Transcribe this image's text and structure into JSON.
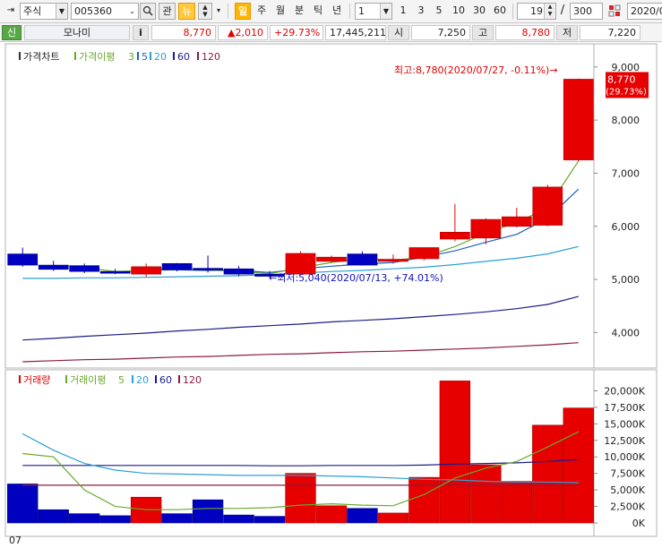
{
  "toolbar": {
    "market": "주식",
    "code": "005360",
    "btn_watch": "관",
    "btn_news": "뉴",
    "periods": [
      "일",
      "주",
      "월",
      "분",
      "틱",
      "년"
    ],
    "interval": "1",
    "quick": [
      "1",
      "3",
      "5",
      "10",
      "30",
      "60"
    ],
    "count": "19",
    "slash": "/",
    "total": "300",
    "date": "2020/0"
  },
  "quote": {
    "tag": "신",
    "name": "모나미",
    "info": "i",
    "price": "8,770",
    "change": "▲2,010",
    "rate": "+29.73%",
    "volume": "17,445,211",
    "open_label": "시",
    "open": "7,250",
    "high_label": "고",
    "high": "8,780",
    "low_label": "저",
    "low": "7,220"
  },
  "colors": {
    "up": "#e60000",
    "down": "#0000c0",
    "ma3": "#6aa82c",
    "ma5": "#1a5fc0",
    "ma20": "#2a9fd6",
    "ma60": "#1b1b8c",
    "ma120": "#8c1b3c",
    "vma5": "#6aa82c",
    "vma20": "#2a9fd6",
    "vma60": "#1b1b8c",
    "vma120": "#8c1b3c"
  },
  "chart_data": [
    {
      "type": "candlestick",
      "legend": {
        "title": "가격차트",
        "ma_label": "가격이평",
        "periods": [
          "3",
          "5",
          "20",
          "60",
          "120"
        ]
      },
      "ylim": [
        3400,
        9300
      ],
      "yticks": [
        "9,000",
        "8,000",
        "7,000",
        "6,000",
        "5,000",
        "4,000"
      ],
      "ytick_values": [
        9000,
        8000,
        7000,
        6000,
        5000,
        4000
      ],
      "current_label": "8,770",
      "current_rate_label": "(29.73%)",
      "current_value": 8770,
      "high_annotation": "최고:8,780(2020/07/27, -0.11%)→",
      "low_annotation": "←최저:5,040(2020/07/13, +74.01%)",
      "candles": [
        {
          "o": 5480,
          "h": 5600,
          "l": 5240,
          "c": 5270
        },
        {
          "o": 5270,
          "h": 5350,
          "l": 5160,
          "c": 5190
        },
        {
          "o": 5260,
          "h": 5300,
          "l": 5120,
          "c": 5150
        },
        {
          "o": 5150,
          "h": 5200,
          "l": 5100,
          "c": 5120
        },
        {
          "o": 5100,
          "h": 5300,
          "l": 5050,
          "c": 5240
        },
        {
          "o": 5300,
          "h": 5310,
          "l": 5150,
          "c": 5180
        },
        {
          "o": 5210,
          "h": 5450,
          "l": 5130,
          "c": 5180
        },
        {
          "o": 5200,
          "h": 5250,
          "l": 5060,
          "c": 5100
        },
        {
          "o": 5100,
          "h": 5160,
          "l": 5040,
          "c": 5060
        },
        {
          "o": 5100,
          "h": 5530,
          "l": 5080,
          "c": 5490
        },
        {
          "o": 5340,
          "h": 5450,
          "l": 5320,
          "c": 5420
        },
        {
          "o": 5480,
          "h": 5530,
          "l": 5260,
          "c": 5270
        },
        {
          "o": 5340,
          "h": 5470,
          "l": 5300,
          "c": 5380
        },
        {
          "o": 5390,
          "h": 5580,
          "l": 5360,
          "c": 5600
        },
        {
          "o": 5760,
          "h": 6420,
          "l": 5720,
          "c": 5890
        },
        {
          "o": 5780,
          "h": 6150,
          "l": 5660,
          "c": 6130
        },
        {
          "o": 6000,
          "h": 6350,
          "l": 5980,
          "c": 6180
        },
        {
          "o": 6020,
          "h": 6780,
          "l": 6000,
          "c": 6740
        },
        {
          "o": 7250,
          "h": 8780,
          "l": 7220,
          "c": 8770
        }
      ],
      "ma3": [
        null,
        null,
        5220,
        5150,
        5170,
        5180,
        5180,
        5150,
        5110,
        5220,
        5320,
        5390,
        5360,
        5420,
        5620,
        5870,
        6070,
        6350,
        7230
      ],
      "ma5": [
        null,
        null,
        null,
        null,
        5220,
        5180,
        5170,
        5170,
        5130,
        5200,
        5250,
        5290,
        5320,
        5420,
        5540,
        5700,
        5850,
        6150,
        6700
      ],
      "ma20": [
        5020,
        5020,
        5030,
        5030,
        5040,
        5050,
        5060,
        5070,
        5090,
        5120,
        5150,
        5170,
        5200,
        5230,
        5280,
        5340,
        5400,
        5480,
        5620
      ],
      "ma60": [
        3860,
        3890,
        3930,
        3960,
        3990,
        4030,
        4060,
        4100,
        4130,
        4160,
        4200,
        4230,
        4260,
        4300,
        4340,
        4390,
        4450,
        4530,
        4680
      ],
      "ma120": [
        3450,
        3470,
        3490,
        3500,
        3520,
        3540,
        3550,
        3570,
        3590,
        3600,
        3620,
        3640,
        3650,
        3670,
        3690,
        3710,
        3740,
        3770,
        3810
      ]
    },
    {
      "type": "bar",
      "legend": {
        "title": "거래량",
        "ma_label": "거래이평",
        "periods": [
          "5",
          "20",
          "60",
          "120"
        ]
      },
      "ylim": [
        0,
        22500
      ],
      "yticks": [
        "20,000K",
        "17,500K",
        "15,000K",
        "12,500K",
        "10,000K",
        "7,500K",
        "5,000K",
        "2,500K",
        "0K"
      ],
      "ytick_values": [
        20000,
        17500,
        15000,
        12500,
        10000,
        7500,
        5000,
        2500,
        0
      ],
      "x_label": "07",
      "volumes": [
        5900,
        2000,
        1400,
        1100,
        3900,
        1400,
        3500,
        1200,
        1000,
        7500,
        2600,
        2200,
        1500,
        6900,
        21500,
        8800,
        6300,
        14800,
        17400
      ],
      "vma5": [
        10500,
        10000,
        5000,
        2500,
        2000,
        2000,
        2200,
        2200,
        2300,
        2700,
        2900,
        2700,
        2600,
        4300,
        6800,
        8300,
        9300,
        11500,
        13800
      ],
      "vma20": [
        13500,
        11000,
        9000,
        8000,
        7500,
        7400,
        7300,
        7200,
        7200,
        7200,
        7100,
        7000,
        6800,
        6600,
        6500,
        6300,
        6200,
        6200,
        6100
      ],
      "vma60": [
        8700,
        8700,
        8700,
        8700,
        8700,
        8700,
        8700,
        8700,
        8650,
        8650,
        8700,
        8700,
        8700,
        8750,
        8900,
        9000,
        9100,
        9300,
        9600
      ],
      "vma120": [
        5700,
        5700,
        5700,
        5700,
        5700,
        5700,
        5700,
        5700,
        5700,
        5700,
        5700,
        5700,
        5700,
        5700,
        5700,
        5700,
        5700,
        5700,
        5700
      ]
    }
  ]
}
